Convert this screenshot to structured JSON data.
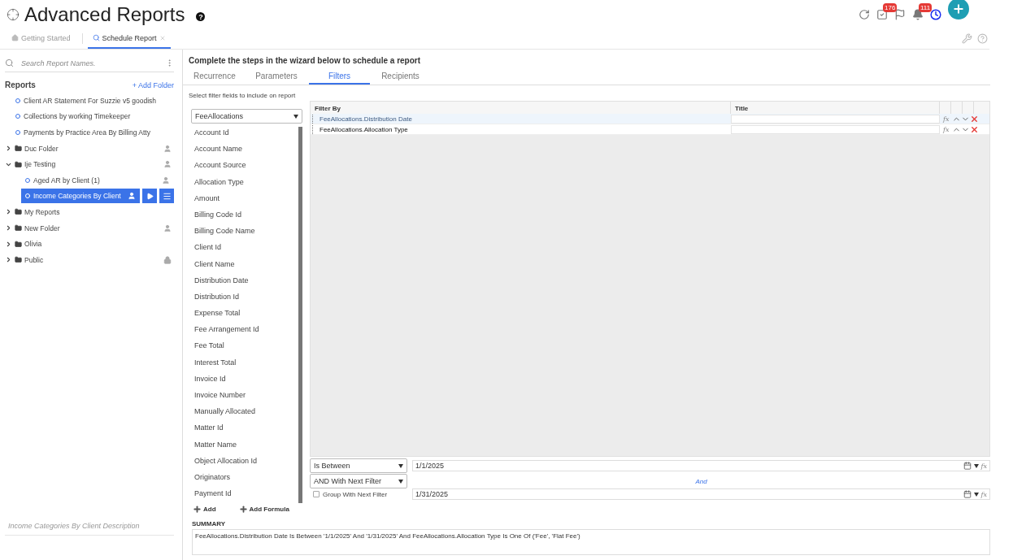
{
  "header": {
    "title": "Advanced Reports",
    "help": "?",
    "badges": [
      {
        "kind": "tasks",
        "count": "176"
      },
      {
        "kind": "alerts",
        "count": "111"
      }
    ]
  },
  "page_tabs": [
    {
      "label": "Getting Started",
      "selected": false,
      "closable": false
    },
    {
      "label": "Schedule Report",
      "selected": true,
      "closable": true
    }
  ],
  "sidebar": {
    "search": {
      "placeholder": "Search Report Names."
    },
    "heading": "Reports",
    "add_folder": "+ Add Folder",
    "tree": [
      {
        "kind": "report",
        "label": "Client AR Statement For Suzzie v5 goodish",
        "shared": false,
        "locked": false,
        "selected": false
      },
      {
        "kind": "report",
        "label": "Collections by working Timekeeper",
        "shared": false,
        "locked": false,
        "selected": false
      },
      {
        "kind": "report",
        "label": "Payments by Practice Area By Billing Atty",
        "shared": false,
        "locked": false,
        "selected": false
      },
      {
        "kind": "folder",
        "label": "Duc Folder",
        "shared": true,
        "locked": false,
        "expanded": false
      },
      {
        "kind": "folder",
        "label": "Ije Testing",
        "shared": true,
        "locked": false,
        "expanded": true,
        "children": [
          {
            "kind": "report",
            "label": "Aged AR by Client (1)",
            "shared": true,
            "locked": false,
            "selected": false
          },
          {
            "kind": "report",
            "label": "Income Categories By Client",
            "shared": true,
            "locked": false,
            "selected": true
          }
        ]
      },
      {
        "kind": "folder",
        "label": "My Reports",
        "shared": false,
        "locked": false,
        "expanded": false
      },
      {
        "kind": "folder",
        "label": "New Folder",
        "shared": true,
        "locked": false,
        "expanded": false
      },
      {
        "kind": "folder",
        "label": "Olivia",
        "shared": false,
        "locked": false,
        "expanded": false
      },
      {
        "kind": "folder",
        "label": "Public",
        "shared": false,
        "locked": true,
        "expanded": false
      }
    ],
    "description": {
      "placeholder": "Income Categories By Client Description"
    }
  },
  "wizard": {
    "heading": "Complete the steps in the wizard below to schedule a report",
    "steps": [
      {
        "label": "Recurrence",
        "selected": false
      },
      {
        "label": "Parameters",
        "selected": false
      },
      {
        "label": "Filters",
        "selected": true
      },
      {
        "label": "Recipients",
        "selected": false
      }
    ],
    "hint": "Select filter fields to include on report",
    "source": "FeeAllocations",
    "fields": [
      "Account Id",
      "Account Name",
      "Account Source",
      "Allocation Type",
      "Amount",
      "Billing Code Id",
      "Billing Code Name",
      "Client Id",
      "Client Name",
      "Distribution Date",
      "Distribution Id",
      "Expense Total",
      "Fee Arrangement Id",
      "Fee Total",
      "Interest Total",
      "Invoice Id",
      "Invoice Number",
      "Manually Allocated",
      "Matter Id",
      "Matter Name",
      "Object Allocation Id",
      "Originators",
      "Payment Id"
    ],
    "grid": {
      "columns": [
        "Filter By",
        "Title"
      ],
      "rows": [
        {
          "filter_by": "FeeAllocations.Distribution Date",
          "formula": "fx",
          "selected": true
        },
        {
          "filter_by": "FeeAllocations.Allocation Type",
          "formula": "fx",
          "selected": false
        }
      ]
    },
    "condition": {
      "operator": "Is Between",
      "from": {
        "value": "1/1/2025",
        "formula": "fx"
      },
      "conjunction": "AND With Next Filter",
      "between_label": "And",
      "to": {
        "value": "1/31/2025",
        "formula": "fx"
      },
      "group": {
        "label": "Group With Next Filter",
        "checked": false
      }
    },
    "actions": [
      "Add",
      "Add Formula"
    ],
    "summary": {
      "label": "SUMMARY",
      "text": "FeeAllocations.Distribution Date Is Between '1/1/2025' And '1/31/2025' And FeeAllocations.Allocation Type Is One Of ('Fee', 'Flat Fee')"
    }
  }
}
